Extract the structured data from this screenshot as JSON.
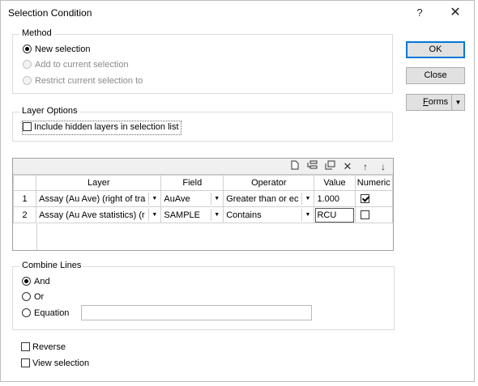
{
  "window": {
    "title": "Selection Condition",
    "help_label": "?",
    "close_label": "✕"
  },
  "method": {
    "legend": "Method",
    "options": [
      "New selection",
      "Add to current selection",
      "Restrict current selection to"
    ]
  },
  "layer_options": {
    "legend": "Layer Options",
    "include_hidden_label": "Include hidden layers in selection list"
  },
  "buttons": {
    "ok": "OK",
    "close": "Close",
    "forms": "Forms",
    "forms_arrow": "▼"
  },
  "grid": {
    "columns": [
      "",
      "Layer",
      "Field",
      "Operator",
      "Value",
      "Numeric"
    ],
    "rows": [
      {
        "num": "1",
        "layer": "Assay (Au Ave) (right of tra",
        "field": "AuAve",
        "operator": "Greater than or ec",
        "value": "1.000",
        "numeric": true
      },
      {
        "num": "2",
        "layer": "Assay (Au Ave statistics) (r",
        "field": "SAMPLE",
        "operator": "Contains",
        "value": "RCU",
        "numeric": false
      }
    ],
    "toolbar_icons": [
      "new-row-icon",
      "insert-row-icon",
      "duplicate-row-icon",
      "delete-row-icon",
      "move-up-icon",
      "move-down-icon"
    ]
  },
  "combine": {
    "legend": "Combine Lines",
    "options": [
      "And",
      "Or",
      "Equation"
    ],
    "equation_value": ""
  },
  "options": {
    "reverse_label": "Reverse",
    "view_selection_label": "View selection"
  }
}
